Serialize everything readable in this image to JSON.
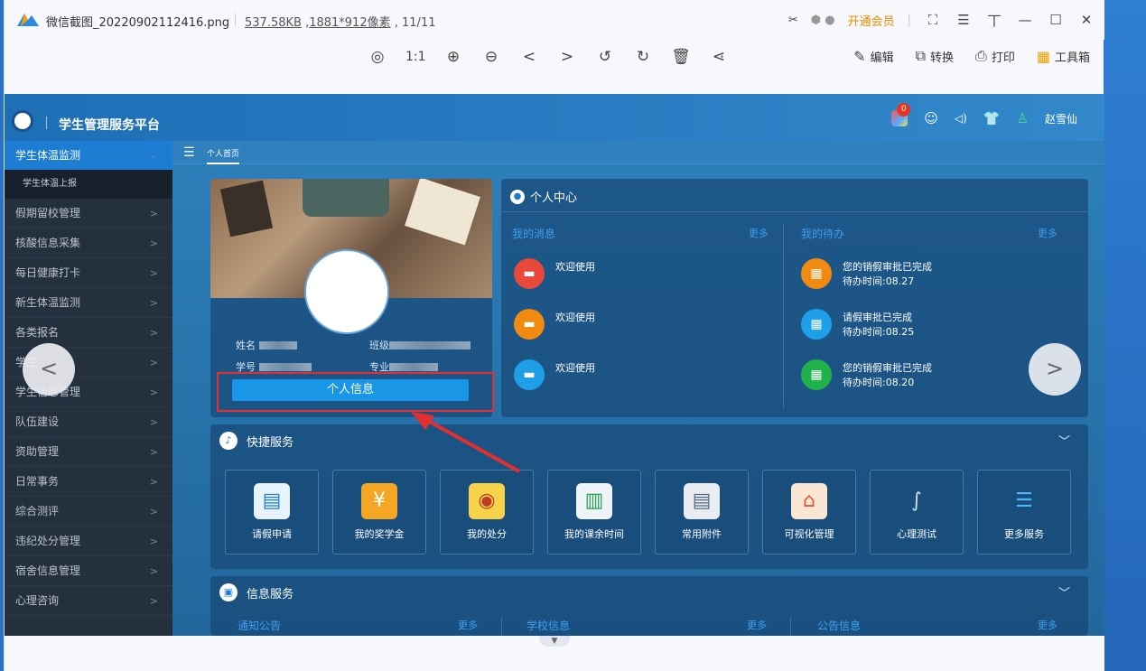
{
  "viewer": {
    "file_name": "微信截图_20220902112416.png",
    "file_size": "537.58KB",
    "dimensions": "1881*912像素",
    "page_index": "11/11",
    "vip_label": "开通会员",
    "tools": [
      "edit",
      "convert",
      "print",
      "toolbox"
    ],
    "edit_label": "编辑",
    "convert_label": "转换",
    "print_label": "打印",
    "toolbox_label": "工具箱",
    "ratio_label": "1:1"
  },
  "app": {
    "platform_title": "学生管理服务平台",
    "badge_count": "0",
    "user_name": "赵雪仙",
    "home_tab": "个人首页"
  },
  "sidebar": {
    "active": "学生体温监测",
    "sub": "学生体温上报",
    "items": [
      "假期留校管理",
      "核酸信息采集",
      "每日健康打卡",
      "新生体温监测",
      "各类报名",
      "学生",
      "学生信息管理",
      "队伍建设",
      "资助管理",
      "日常事务",
      "综合测评",
      "违纪处分管理",
      "宿舍信息管理",
      "心理咨询"
    ]
  },
  "profile": {
    "name_label": "姓名",
    "class_label": "班级",
    "id_label": "学号",
    "major_label": "专业",
    "info_button": "个人信息"
  },
  "center": {
    "title": "个人中心",
    "messages_title": "我的消息",
    "todo_title": "我的待办",
    "more": "更多",
    "messages": [
      {
        "text": "欢迎使用",
        "color": "#e8493b"
      },
      {
        "text": "欢迎使用",
        "color": "#f08a10"
      },
      {
        "text": "欢迎使用",
        "color": "#1e9fe8"
      }
    ],
    "todos": [
      {
        "title": "您的销假审批已完成",
        "time": "待办时间:08.27",
        "color": "#f08a10"
      },
      {
        "title": "请假审批已完成",
        "time": "待办时间:08.25",
        "color": "#1e9fe8"
      },
      {
        "title": "您的销假审批已完成",
        "time": "待办时间:08.20",
        "color": "#21b14b"
      }
    ]
  },
  "quick": {
    "title": "快捷服务",
    "services": [
      "请假申请",
      "我的奖学金",
      "我的处分",
      "我的课余时间",
      "常用附件",
      "可视化管理",
      "心理测试",
      "更多服务"
    ]
  },
  "info": {
    "title": "信息服务",
    "cols": [
      "通知公告",
      "学校信息",
      "公告信息"
    ],
    "more": "更多"
  },
  "colors": {
    "accent": "#1996e8",
    "sidebar_bg": "#25303f",
    "header_bg": "#1d6fb6",
    "highlight_red": "#e62e2e"
  }
}
